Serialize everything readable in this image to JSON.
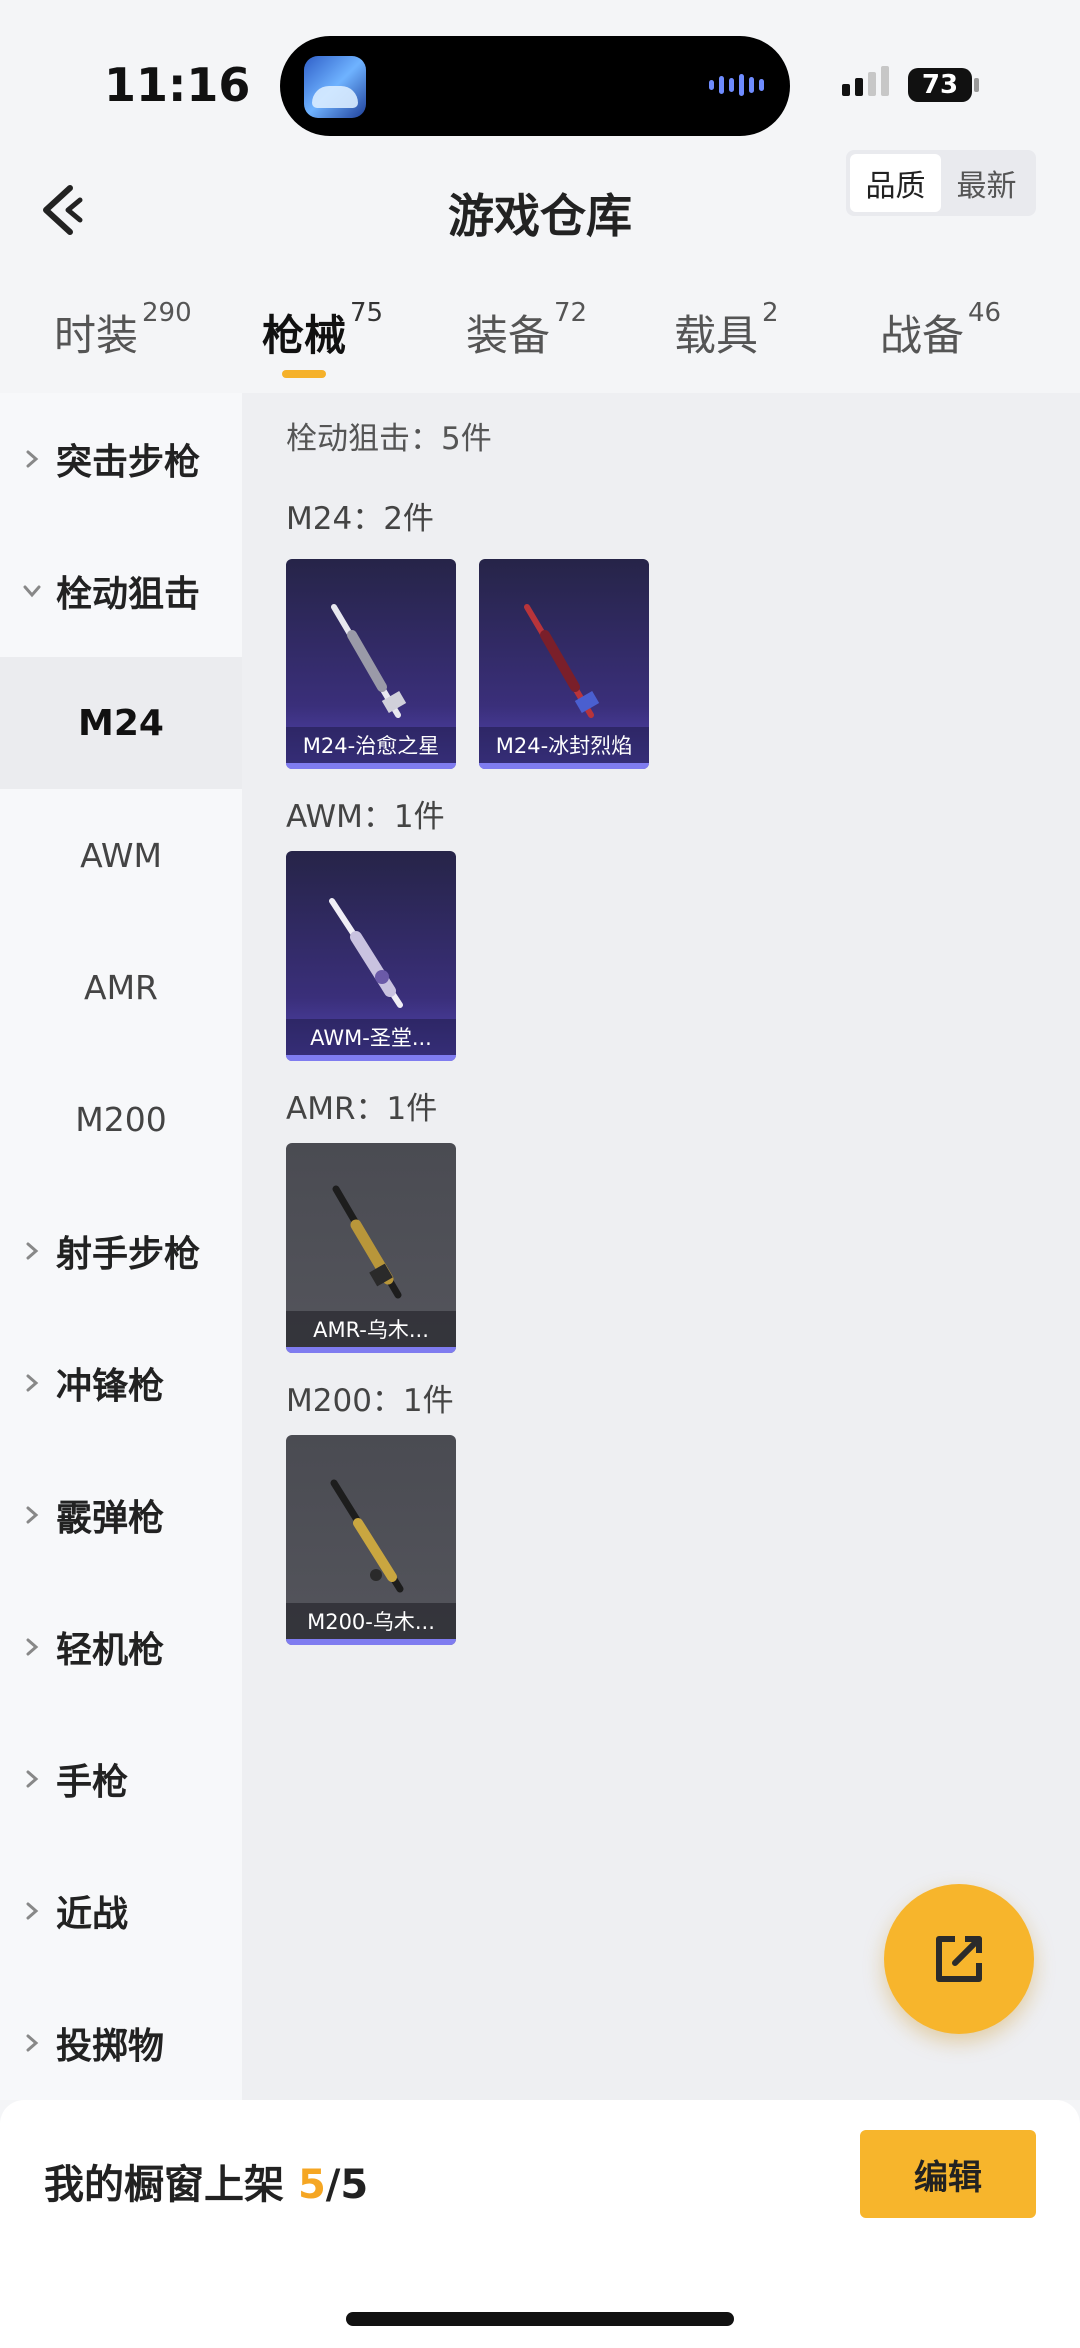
{
  "status": {
    "time": "11:16",
    "battery": "73"
  },
  "header": {
    "title": "游戏仓库",
    "sort": [
      "品质",
      "最新"
    ]
  },
  "tabs": [
    {
      "label": "时装",
      "count": "290"
    },
    {
      "label": "枪械",
      "count": "75"
    },
    {
      "label": "装备",
      "count": "72"
    },
    {
      "label": "载具",
      "count": "2"
    },
    {
      "label": "战备",
      "count": "46"
    }
  ],
  "sidebar": {
    "assault": "突击步枪",
    "sniper": "栓动狙击",
    "subs": [
      "M24",
      "AWM",
      "AMR",
      "M200"
    ],
    "categories": [
      "射手步枪",
      "冲锋枪",
      "霰弹枪",
      "轻机枪",
      "手枪",
      "近战",
      "投掷物"
    ]
  },
  "content": {
    "summary": "栓动狙击：5件",
    "groups": [
      {
        "title": "M24：2件",
        "items": [
          "M24-治愈之星",
          "M24-冰封烈焰"
        ]
      },
      {
        "title": "AWM：1件",
        "items": [
          "AWM-圣堂..."
        ]
      },
      {
        "title": "AMR：1件",
        "items": [
          "AMR-乌木..."
        ]
      },
      {
        "title": "M200：1件",
        "items": [
          "M200-乌木..."
        ]
      }
    ]
  },
  "bottom": {
    "showcase_label": "我的橱窗上架",
    "showcase_current": "5",
    "showcase_total": "/5",
    "edit_label": "编辑"
  },
  "colors": {
    "accent": "#f7b52c",
    "rare_card": "#3a2f7a",
    "common_card": "#54555c"
  }
}
